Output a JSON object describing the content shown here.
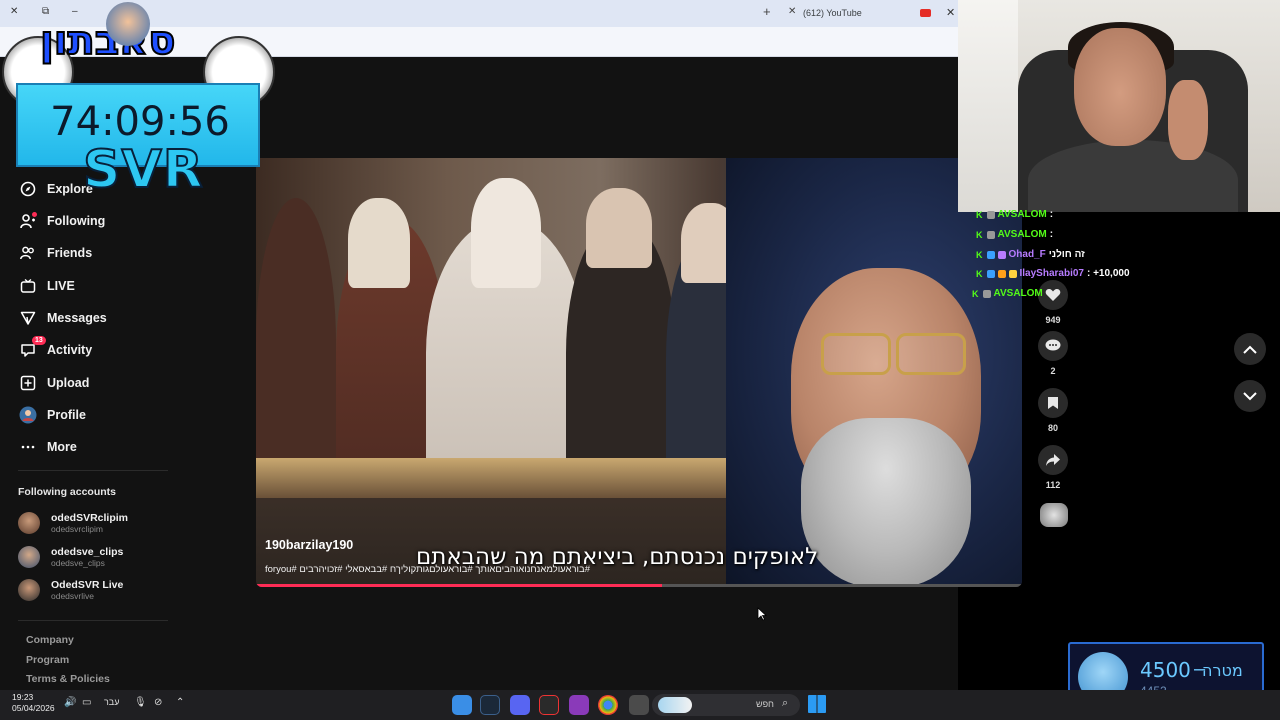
{
  "browser": {
    "tab_title": "(612) YouTube",
    "new_tab": "+",
    "close": "✕"
  },
  "sidebar": {
    "items": [
      {
        "label": "Explore",
        "icon": "compass-icon"
      },
      {
        "label": "Following",
        "icon": "user-follow-icon"
      },
      {
        "label": "Friends",
        "icon": "friends-icon"
      },
      {
        "label": "LIVE",
        "icon": "live-tv-icon"
      },
      {
        "label": "Messages",
        "icon": "paper-plane-icon"
      },
      {
        "label": "Activity",
        "icon": "message-bubble-icon",
        "badge": "13"
      },
      {
        "label": "Upload",
        "icon": "plus-square-icon"
      },
      {
        "label": "Profile",
        "icon": "avatar-icon"
      },
      {
        "label": "More",
        "icon": "ellipsis-icon"
      }
    ],
    "following_title": "Following accounts",
    "following": [
      {
        "name": "odedSVRclipim",
        "handle": "odedsvrclipim"
      },
      {
        "name": "odedsve_clips",
        "handle": "odedsve_clips"
      },
      {
        "name": "OdedSVR Live",
        "handle": "odedsvrlive"
      }
    ],
    "footer": [
      "Company",
      "Program",
      "Terms & Policies"
    ]
  },
  "video": {
    "username": "190barzilay190",
    "tags": "#בוראעולמאנחנואוהביםאותך #בוראעולםגותקוליךח #בבאסאלי #זכויהרבים #foryou",
    "subtitle": "לאופקים נכנסתם, ביציאתם מה שהבאתם",
    "progress": 0.53
  },
  "actions": [
    {
      "name": "like",
      "icon": "heart-icon",
      "count": "949"
    },
    {
      "name": "comment",
      "icon": "comment-icon",
      "count": "2"
    },
    {
      "name": "save",
      "icon": "bookmark-icon",
      "count": "80"
    },
    {
      "name": "share",
      "icon": "share-arrow-icon",
      "count": "112"
    }
  ],
  "chat": [
    {
      "user": "AVSALOM",
      "text": ":",
      "color": "#53fc18"
    },
    {
      "user": "AVSALOM",
      "text": ":",
      "color": "#53fc18"
    },
    {
      "user": "Ohad_F",
      "text": "זה חולני",
      "color": "#b77cff"
    },
    {
      "user": "IlaySharabi07",
      "text": ": +10,000",
      "color": "#b77cff"
    },
    {
      "user": "AVSALOM",
      "text": "",
      "color": "#53fc18"
    }
  ],
  "overlay": {
    "logo": "סאבתון",
    "timer": "74:09:56",
    "brand": "SVR"
  },
  "goal": {
    "target": "4500",
    "label": "מטרה",
    "current": "4452",
    "dash": "–"
  },
  "taskbar": {
    "time": "19:23",
    "date": "05/04/2026",
    "lang": "עבר",
    "search": "חפש"
  },
  "colors": {
    "accent": "#fe2c55",
    "kick_green": "#53fc18",
    "timer_blue": "#2dc7f2"
  }
}
